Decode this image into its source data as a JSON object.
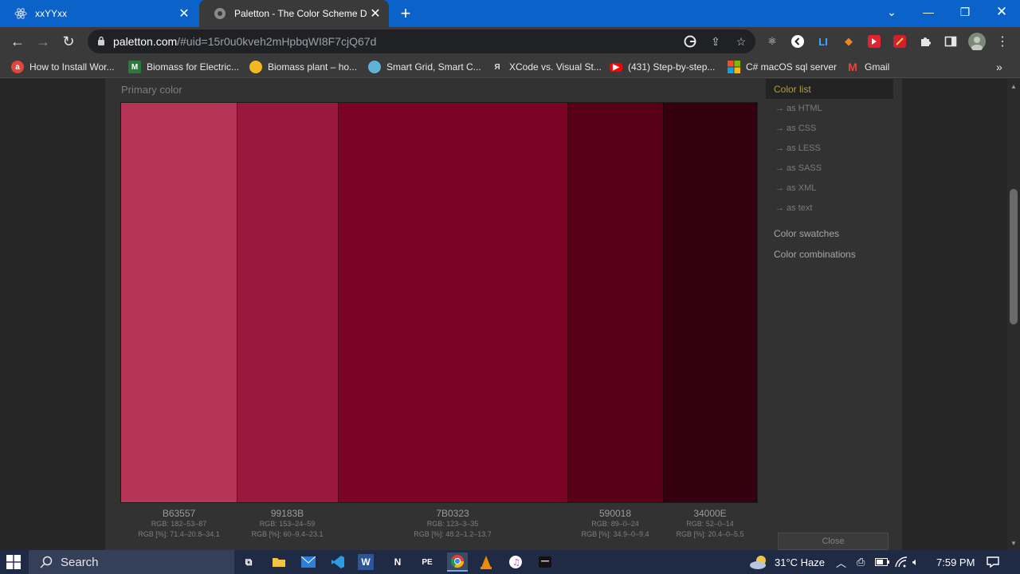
{
  "browser": {
    "tabs": [
      {
        "title": "xxYYxx",
        "active": false,
        "icon": "react-icon"
      },
      {
        "title": "Paletton - The Color Scheme Des",
        "active": true,
        "icon": "paletton-icon"
      }
    ],
    "url": {
      "host": "paletton.com",
      "path": "/#uid=15r0u0kveh2mHpbqWI8F7cjQ67d"
    },
    "bookmarks": [
      {
        "label": "How to Install Wor...",
        "icon_color": "#e0463c"
      },
      {
        "label": "Biomass for Electric...",
        "icon_color": "#2b7a3b"
      },
      {
        "label": "Biomass plant – ho...",
        "icon_color": "#f2b824"
      },
      {
        "label": "Smart Grid, Smart C...",
        "icon_color": "#5fb2d8"
      },
      {
        "label": "XCode vs. Visual St...",
        "icon_color": "#444444"
      },
      {
        "label": "(431) Step-by-step...",
        "icon_color": "#ff0000"
      },
      {
        "label": "C# macOS sql server",
        "icon_color": "#f25022"
      },
      {
        "label": "Gmail",
        "icon_color": "#ea4335"
      }
    ]
  },
  "page": {
    "section_title": "Primary color",
    "swatches": [
      {
        "hex": "B63557",
        "color": "#B63557",
        "rgb": "RGB: 182–53–87",
        "pct": "RGB [%]: 71.4–20.8–34.1"
      },
      {
        "hex": "99183B",
        "color": "#99183B",
        "rgb": "RGB: 153–24–59",
        "pct": "RGB [%]: 60–9.4–23.1"
      },
      {
        "hex": "7B0323",
        "color": "#7B0323",
        "rgb": "RGB: 123–3–35",
        "pct": "RGB [%]: 48.2–1.2–13.7"
      },
      {
        "hex": "590018",
        "color": "#590018",
        "rgb": "RGB: 89–0–24",
        "pct": "RGB [%]: 34.9–0–9.4"
      },
      {
        "hex": "34000E",
        "color": "#34000E",
        "rgb": "RGB: 52–0–14",
        "pct": "RGB [%]: 20.4–0–5.5"
      }
    ],
    "menu": {
      "active": "Color list",
      "sub_items": [
        "→ as HTML",
        "→ as CSS",
        "→ as LESS",
        "→ as SASS",
        "→ as XML",
        "→ as text"
      ],
      "main_items": [
        "Color swatches",
        "Color combinations"
      ]
    },
    "close_label": "Close"
  },
  "taskbar": {
    "search_label": "Search",
    "weather": "31°C  Haze",
    "time": "7:59 PM"
  }
}
